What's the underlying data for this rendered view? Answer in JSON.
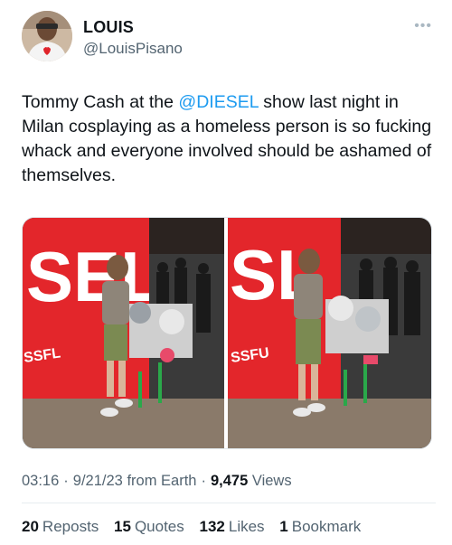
{
  "author": {
    "display_name": "LOUIS",
    "handle": "@LouisPisano",
    "avatar_icon": "profile-photo"
  },
  "more_icon": "ellipsis-icon",
  "tweet": {
    "text_before": "Tommy Cash at the ",
    "mention": "@DIESEL",
    "text_after": " show last night in Milan cosplaying as a homeless person is so fucking whack and everyone involved should be ashamed of themselves."
  },
  "media": {
    "photo_left_sign": "SEL",
    "photo_left_sign_small": "SSFL",
    "photo_right_sign": "SL",
    "photo_right_sign_small": "SSFU"
  },
  "meta": {
    "time": "03:16",
    "date": "9/21/23",
    "source": "from Earth",
    "views_count": "9,475",
    "views_label": "Views",
    "separator": "·"
  },
  "stats": {
    "reposts_count": "20",
    "reposts_label": "Reposts",
    "quotes_count": "15",
    "quotes_label": "Quotes",
    "likes_count": "132",
    "likes_label": "Likes",
    "bookmarks_count": "1",
    "bookmarks_label": "Bookmark"
  },
  "colors": {
    "accent": "#1d9bf0",
    "secondary_text": "#536471",
    "primary_text": "#0f1419",
    "banner_red": "#e3262b"
  }
}
